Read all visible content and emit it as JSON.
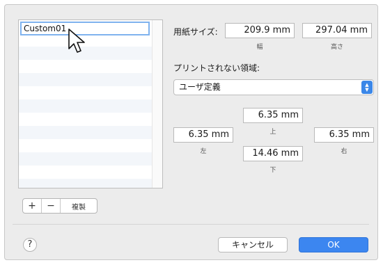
{
  "list": {
    "name_value": "Custom01",
    "row_count": 12
  },
  "buttons": {
    "add": "+",
    "remove": "−",
    "duplicate": "複製",
    "help": "?",
    "cancel": "キャンセル",
    "ok": "OK"
  },
  "paper_size": {
    "label": "用紙サイズ:",
    "width_value": "209.9 mm",
    "width_caption": "幅",
    "height_value": "297.04 mm",
    "height_caption": "高さ"
  },
  "margins": {
    "label": "プリントされない領域:",
    "preset": "ユーザ定義",
    "top_value": "6.35 mm",
    "top_caption": "上",
    "left_value": "6.35 mm",
    "left_caption": "左",
    "right_value": "6.35 mm",
    "right_caption": "右",
    "bottom_value": "14.46 mm",
    "bottom_caption": "下"
  },
  "colors": {
    "accent": "#3c86f0",
    "focus_ring": "#7fb2ee"
  },
  "icons": [
    "arrow-cursor-icon",
    "help-icon",
    "popup-stepper-icon"
  ]
}
